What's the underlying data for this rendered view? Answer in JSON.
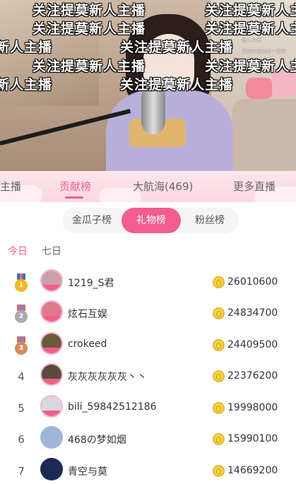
{
  "stream": {
    "danmaku": [
      "关注提莫新人主播",
      "关注提莫新人主播",
      "关注提莫新人主播",
      "关注提莫新人主播",
      "新人主播",
      "关注提莫新人主播",
      "关注提莫新人主播",
      "关注提莫新人主播",
      "新人主播",
      "关注提莫新人主播"
    ],
    "newbie_badge": "新人主播",
    "newbie_note": "每周可领福利一波呀"
  },
  "tabs": [
    {
      "label": "主播",
      "active": false
    },
    {
      "label": "贡献榜",
      "active": true
    },
    {
      "label": "大航海(469)",
      "active": false
    },
    {
      "label": "更多直播",
      "active": false
    }
  ],
  "subtabs": [
    {
      "label": "金瓜子榜",
      "active": false
    },
    {
      "label": "礼物榜",
      "active": true
    },
    {
      "label": "粉丝榜",
      "active": false
    }
  ],
  "periods": [
    {
      "label": "今日",
      "active": true
    },
    {
      "label": "七日",
      "active": false
    }
  ],
  "ranking": [
    {
      "rank": "1",
      "medal": "gold",
      "name": "1219_S君",
      "score": "26010600",
      "avatar_color": "#c9a0a8"
    },
    {
      "rank": "2",
      "medal": "silver",
      "name": "炫石互娱",
      "score": "24834700",
      "avatar_color": "#e07a8e"
    },
    {
      "rank": "3",
      "medal": "bronze",
      "name": "crokeed",
      "score": "24409500",
      "avatar_color": "#6b5a3c"
    },
    {
      "rank": "4",
      "medal": "",
      "name": "灰灰灰灰灰灰丶丶",
      "score": "22376200",
      "avatar_color": "#5d4a3a"
    },
    {
      "rank": "5",
      "medal": "",
      "name": "bili_59842512186",
      "score": "19998000",
      "avatar_color": "#d8d8e0"
    },
    {
      "rank": "6",
      "medal": "",
      "name": "468の梦如烟",
      "score": "15990100",
      "avatar_color": "#9fb6d8"
    },
    {
      "rank": "7",
      "medal": "",
      "name": "青空与莫",
      "score": "14669200",
      "avatar_color": "#1b2a55"
    }
  ]
}
